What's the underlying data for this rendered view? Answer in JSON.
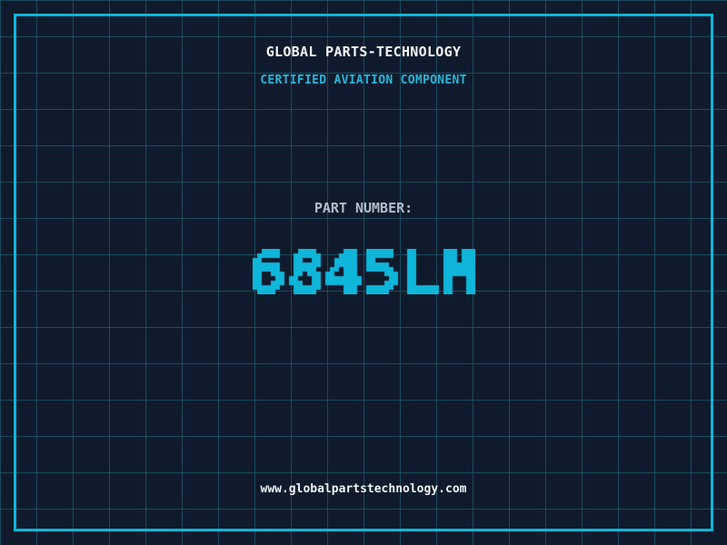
{
  "colors": {
    "background": "#0f1b2c",
    "grid_line": "#1b4a5e",
    "frame_border": "#0bb5d8",
    "accent": "#0fb6da",
    "company_text": "#f4f7f9",
    "label_text": "#b2bdc7",
    "url_text": "#eef2f5"
  },
  "header": {
    "company_name": "GLOBAL PARTS-TECHNOLOGY",
    "tagline": "CERTIFIED AVIATION COMPONENT"
  },
  "part": {
    "label": "PART NUMBER:",
    "number": "6845LM"
  },
  "footer": {
    "website": "www.globalpartstechnology.com"
  }
}
